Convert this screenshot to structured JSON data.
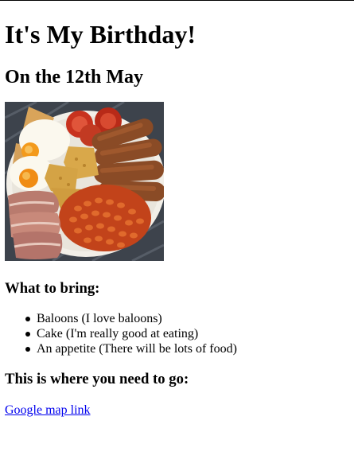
{
  "page": {
    "title": "It's My Birthday!",
    "subtitle": "On the 12th May"
  },
  "image": {
    "alt": "Full English breakfast",
    "icon": "breakfast-plate-image"
  },
  "bring": {
    "heading": "What to bring:",
    "items": [
      "Baloons (I love baloons)",
      "Cake (I'm really good at eating)",
      "An appetite (There will be lots of food)"
    ]
  },
  "directions": {
    "heading": "This is where you need to go:",
    "link_text": "Google map link"
  },
  "colors": {
    "link": "#0000ee",
    "text": "#000000",
    "background": "#ffffff"
  }
}
